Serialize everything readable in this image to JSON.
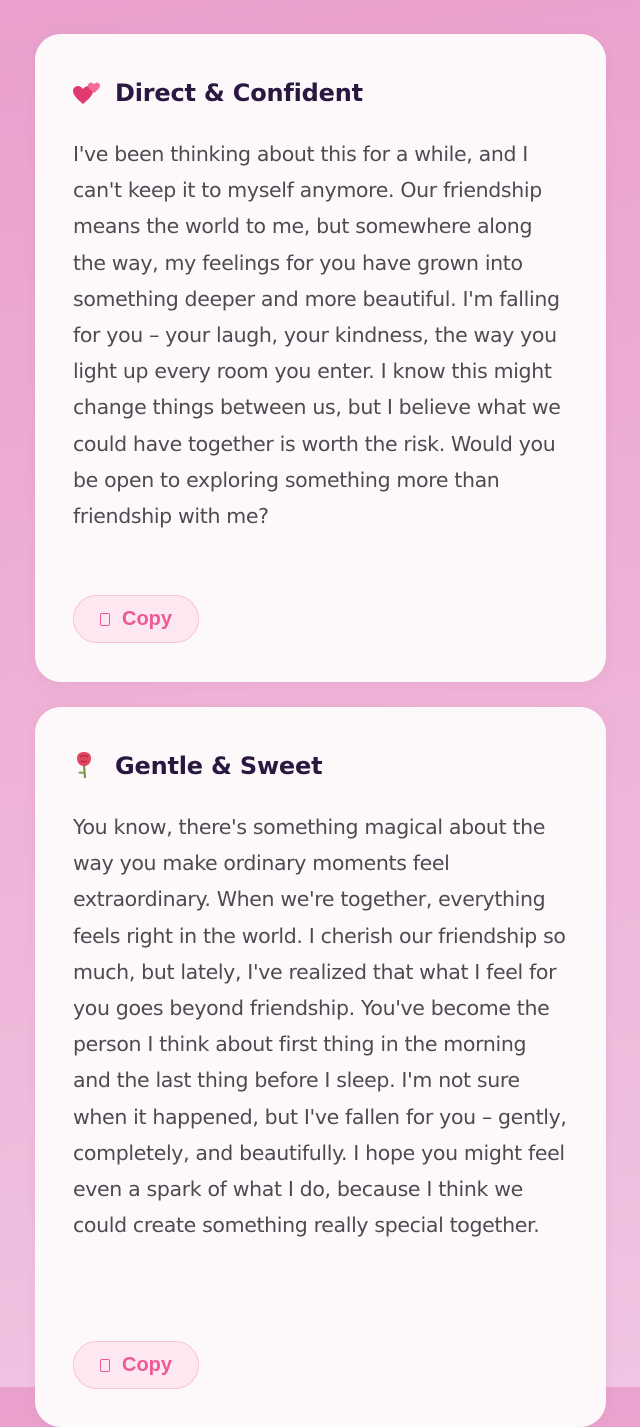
{
  "cards": [
    {
      "icon": "two-hearts-icon",
      "title": "Direct & Confident",
      "body": "I've been thinking about this for a while, and I can't keep it to myself anymore. Our friendship means the world to me, but somewhere along the way, my feelings for you have grown into something deeper and more beautiful. I'm falling for you – your laugh, your kindness, the way you light up every room you enter. I know this might change things between us, but I believe what we could have together is worth the risk. Would you be open to exploring something more than friendship with me?",
      "copy_label": "Copy"
    },
    {
      "icon": "rose-icon",
      "title": "Gentle & Sweet",
      "body": "You know, there's something magical about the way you make ordinary moments feel extraordinary. When we're together, everything feels right in the world. I cherish our friendship so much, but lately, I've realized that what I feel for you goes beyond friendship. You've become the person I think about first thing in the morning and the last thing before I sleep. I'm not sure when it happened, but I've fallen for you – gently, completely, and beautifully. I hope you might feel even a spark of what I do, because I think we could create something really special together.",
      "copy_label": "Copy"
    }
  ],
  "colors": {
    "accent": "#ef5a96",
    "title": "#2a1840",
    "body": "#4f4a52",
    "card": "#fdf9fb"
  }
}
